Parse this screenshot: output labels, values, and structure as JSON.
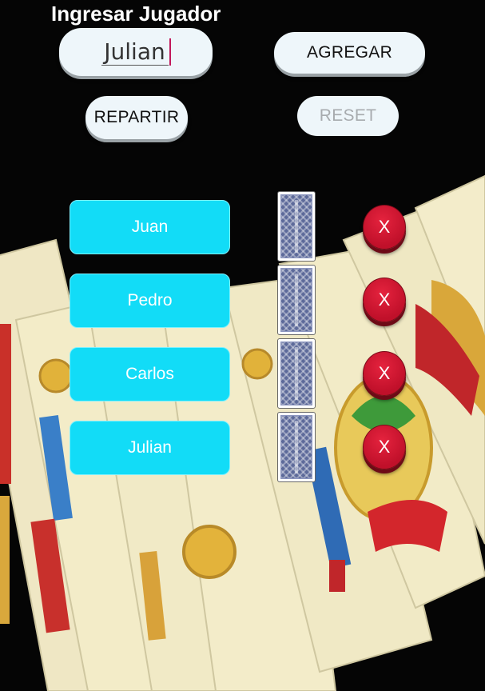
{
  "form": {
    "title": "Ingresar Jugador",
    "player_input_value": "Julian",
    "add_label": "AGREGAR",
    "deal_label": "REPARTIR",
    "reset_label": "RESET"
  },
  "players": [
    {
      "name": "Juan",
      "delete_label": "X"
    },
    {
      "name": "Pedro",
      "delete_label": "X"
    },
    {
      "name": "Carlos",
      "delete_label": "X"
    },
    {
      "name": "Julian",
      "delete_label": "X"
    }
  ],
  "colors": {
    "player_button": "#12dcf7",
    "delete_button": "#d4162f",
    "pill_button": "#eef6fa",
    "reset_disabled_text": "#a7abae",
    "background_card": "#f3ecc8"
  },
  "icons": {
    "card_back": "card-back-icon",
    "delete": "delete-x"
  }
}
